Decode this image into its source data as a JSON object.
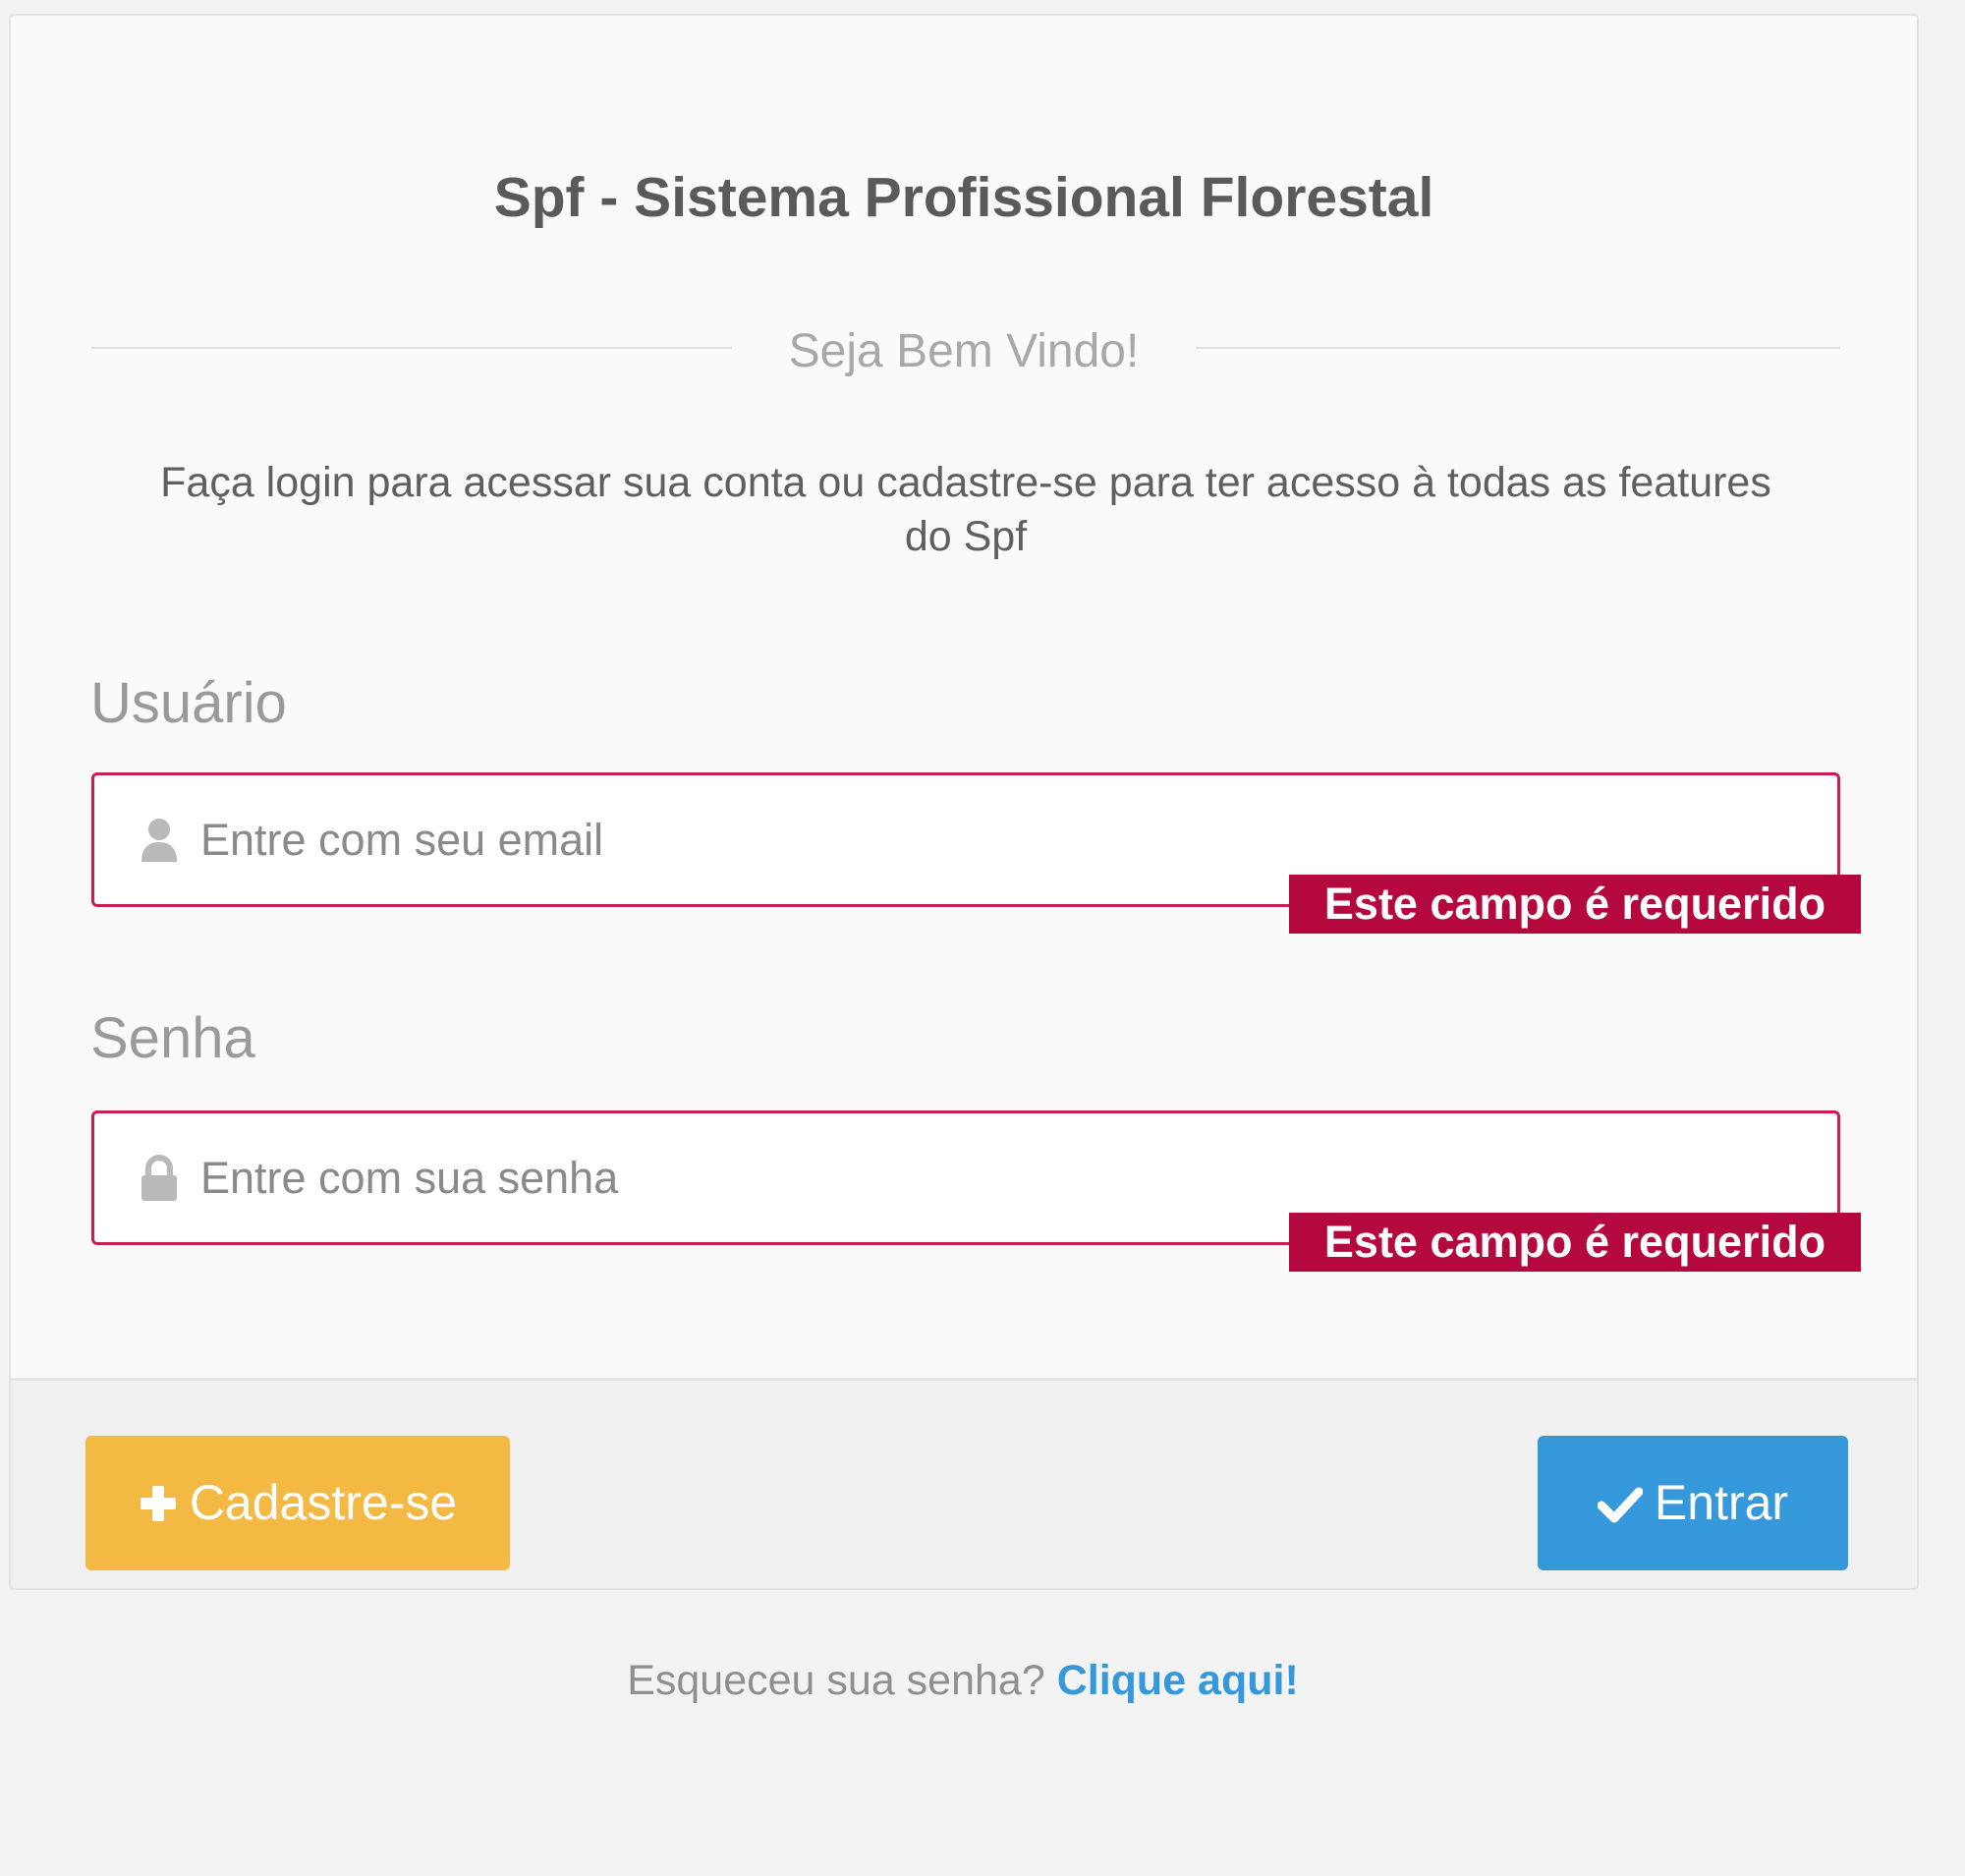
{
  "header": {
    "title": "Spf - Sistema Profissional Florestal",
    "welcome": "Seja Bem Vindo!",
    "intro_line1": "Faça login para acessar sua conta ou cadastre-se para ter acesso à todas as features",
    "intro_line2": "do Spf"
  },
  "form": {
    "user": {
      "label": "Usuário",
      "placeholder": "Entre com seu email",
      "value": "",
      "icon": "user-icon",
      "error": "Este campo é requerido"
    },
    "password": {
      "label": "Senha",
      "placeholder": "Entre com sua senha",
      "value": "",
      "icon": "lock-icon",
      "error": "Este campo é requerido"
    }
  },
  "actions": {
    "register_label": "Cadastre-se",
    "register_icon": "plus-icon",
    "login_label": "Entrar",
    "login_icon": "check-icon"
  },
  "forgot": {
    "text": "Esqueceu sua senha?",
    "link": "Clique aqui!"
  },
  "colors": {
    "error": "#b5083f",
    "input_border_error": "#c81e52",
    "register_button": "#f4b942",
    "login_button": "#3498db",
    "link": "#3498db"
  }
}
